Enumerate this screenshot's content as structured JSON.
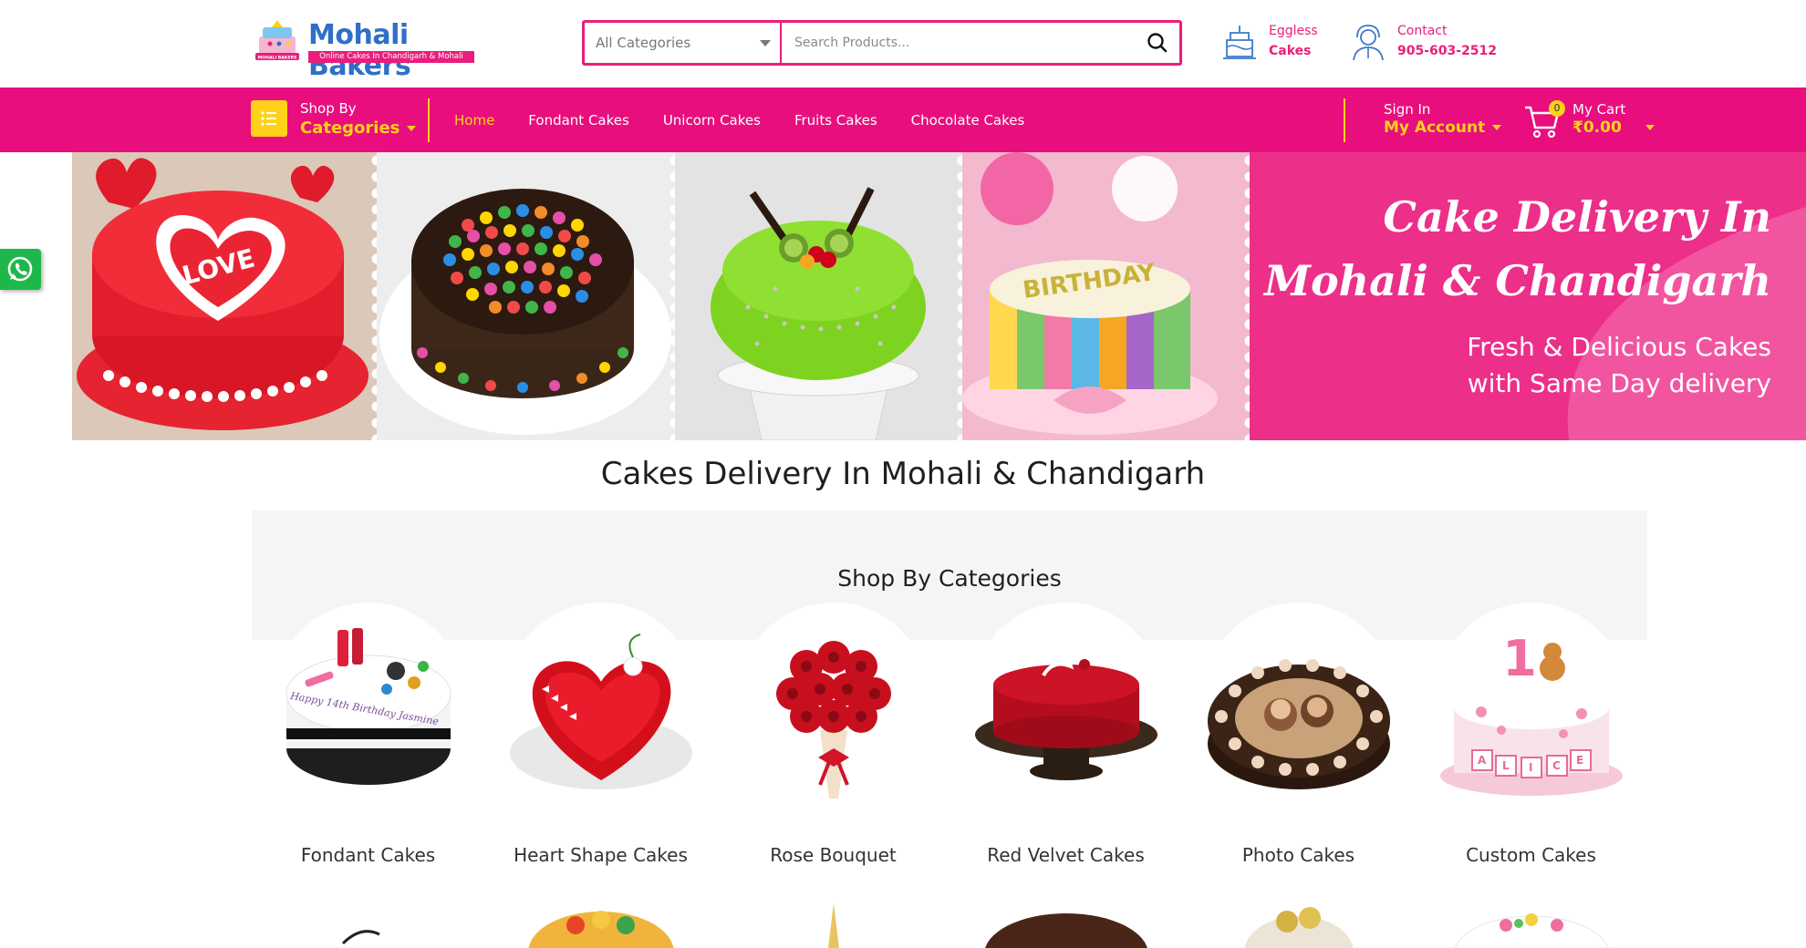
{
  "header": {
    "logo_title": "Mohali Bakers",
    "logo_tagline": "Online Cakes In Chandigarh & Mohali",
    "logo_badge": "MOHALI BAKERS",
    "search": {
      "category_selected": "All Categories",
      "placeholder": "Search Products..."
    },
    "eggless": {
      "line1": "Eggless",
      "line2": "Cakes"
    },
    "contact": {
      "line1": "Contact",
      "line2": "905-603-2512"
    }
  },
  "nav": {
    "shop_by": "Shop By",
    "categories": "Categories",
    "links": [
      "Home",
      "Fondant Cakes",
      "Unicorn Cakes",
      "Fruits Cakes",
      "Chocolate Cakes"
    ],
    "active": "Home",
    "sign_in": "Sign In",
    "my_account": "My Account",
    "cart_label": "My Cart",
    "cart_total": "₹0.00",
    "cart_count": "0"
  },
  "banner": {
    "heading_line1": "Cake Delivery In",
    "heading_line2": "Mohali & Chandigarh",
    "sub_line1": "Fresh & Delicious Cakes",
    "sub_line2": "with Same Day delivery",
    "cake_text": "LOVE",
    "topper_text": "BIRTHDAY"
  },
  "main": {
    "title": "Cakes Delivery In Mohali & Chandigarh",
    "categories_heading": "Shop By Categories",
    "categories": [
      {
        "name": "Fondant Cakes",
        "icon": "makeup-cake-icon",
        "cake_text": "Happy 14th Birthday Jasmine"
      },
      {
        "name": "Heart Shape Cakes",
        "icon": "heart-cake-icon"
      },
      {
        "name": "Rose Bouquet",
        "icon": "rose-bouquet-icon"
      },
      {
        "name": "Red Velvet Cakes",
        "icon": "red-velvet-cake-icon"
      },
      {
        "name": "Photo Cakes",
        "icon": "photo-cake-icon"
      },
      {
        "name": "Custom Cakes",
        "icon": "custom-cake-icon",
        "topper_text": "1",
        "blocks_text": "ALICE"
      }
    ]
  },
  "colors": {
    "brand_pink": "#e80e7e",
    "accent_yellow": "#ffd11a",
    "logo_blue": "#2f6fc7"
  }
}
